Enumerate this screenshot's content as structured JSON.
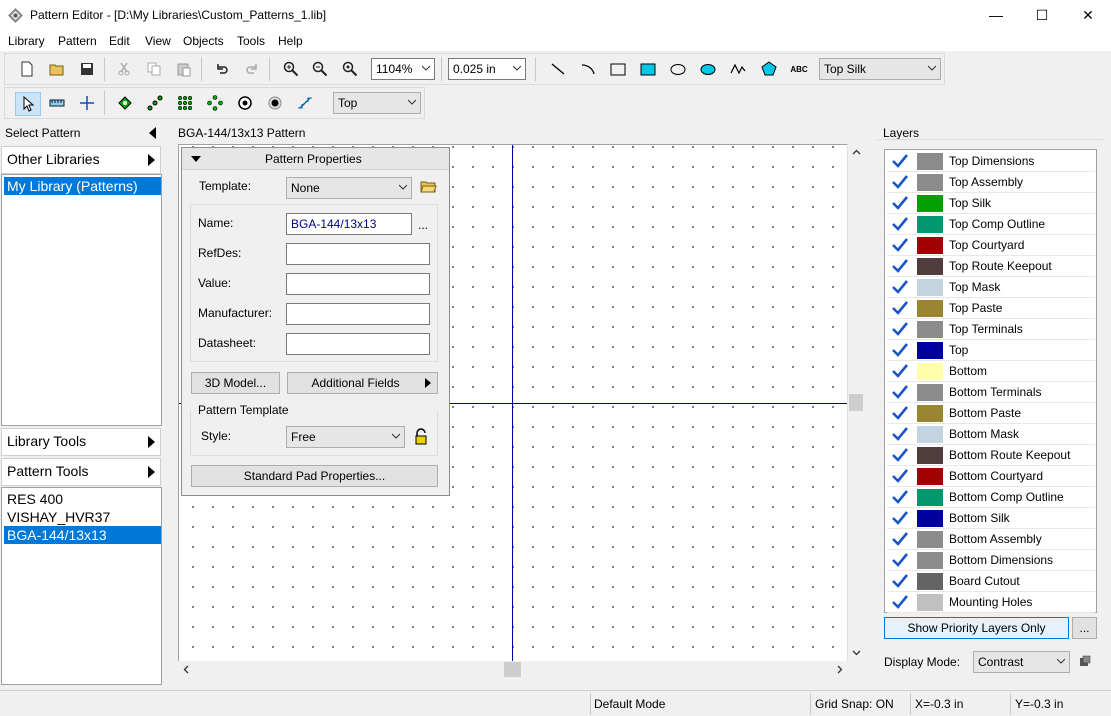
{
  "window": {
    "title": "Pattern Editor - [D:\\My Libraries\\Custom_Patterns_1.lib]",
    "minimize": "—",
    "maximize": "☐",
    "close": "✕"
  },
  "menu": [
    "Library",
    "Pattern",
    "Edit",
    "View",
    "Objects",
    "Tools",
    "Help"
  ],
  "toolbar": {
    "zoom_value": "1104%",
    "grid_value": "0.025 in",
    "layer_value": "Top Silk",
    "side_value": "Top",
    "text_tool": "ABC"
  },
  "left_panel": {
    "header": "Select Pattern",
    "other_libraries": "Other Libraries",
    "libraries": [
      "My Library (Patterns)"
    ],
    "library_tools": "Library Tools",
    "pattern_tools": "Pattern Tools",
    "patterns": [
      "RES 400",
      "VISHAY_HVR37",
      "BGA-144/13x13"
    ]
  },
  "canvas": {
    "title": "BGA-144/13x13 Pattern"
  },
  "pattern_properties": {
    "header": "Pattern Properties",
    "template_label": "Template:",
    "template_value": "None",
    "name_label": "Name:",
    "name_value": "BGA-144/13x13",
    "name_more": "...",
    "refdes_label": "RefDes:",
    "value_label": "Value:",
    "manufacturer_label": "Manufacturer:",
    "datasheet_label": "Datasheet:",
    "model3d_button": "3D Model...",
    "additional_fields_button": "Additional Fields",
    "pattern_template_group": "Pattern Template",
    "style_label": "Style:",
    "style_value": "Free",
    "standard_pad_button": "Standard Pad Properties..."
  },
  "layers": {
    "header": "Layers",
    "items": [
      {
        "name": "Top Dimensions",
        "color": "#8c8c8c"
      },
      {
        "name": "Top Assembly",
        "color": "#8c8c8c"
      },
      {
        "name": "Top Silk",
        "color": "#00a000"
      },
      {
        "name": "Top Comp Outline",
        "color": "#00966e"
      },
      {
        "name": "Top Courtyard",
        "color": "#a00000"
      },
      {
        "name": "Top Route Keepout",
        "color": "#503c3c"
      },
      {
        "name": "Top Mask",
        "color": "#c3d4e0"
      },
      {
        "name": "Top Paste",
        "color": "#9a8632"
      },
      {
        "name": "Top Terminals",
        "color": "#8c8c8c"
      },
      {
        "name": "Top",
        "color": "#0000a0"
      },
      {
        "name": "Bottom",
        "color": "#ffffaa"
      },
      {
        "name": "Bottom Terminals",
        "color": "#8c8c8c"
      },
      {
        "name": "Bottom Paste",
        "color": "#9a8632"
      },
      {
        "name": "Bottom Mask",
        "color": "#c3d4e0"
      },
      {
        "name": "Bottom Route Keepout",
        "color": "#503c3c"
      },
      {
        "name": "Bottom Courtyard",
        "color": "#a00000"
      },
      {
        "name": "Bottom Comp Outline",
        "color": "#00966e"
      },
      {
        "name": "Bottom Silk",
        "color": "#0000a0"
      },
      {
        "name": "Bottom Assembly",
        "color": "#8c8c8c"
      },
      {
        "name": "Bottom Dimensions",
        "color": "#8c8c8c"
      },
      {
        "name": "Board Cutout",
        "color": "#646464"
      },
      {
        "name": "Mounting Holes",
        "color": "#c0c0c0"
      }
    ],
    "show_priority_button": "Show Priority Layers Only",
    "more_button": "...",
    "display_mode_label": "Display Mode:",
    "display_mode_value": "Contrast"
  },
  "status": {
    "mode": "Default Mode",
    "grid_snap": "Grid Snap: ON",
    "x": "X=-0.3 in",
    "y": "Y=-0.3 in"
  },
  "colors": {
    "selection": "#0078d7",
    "crosshair": "#0000a0",
    "check": "#1a56c8"
  }
}
